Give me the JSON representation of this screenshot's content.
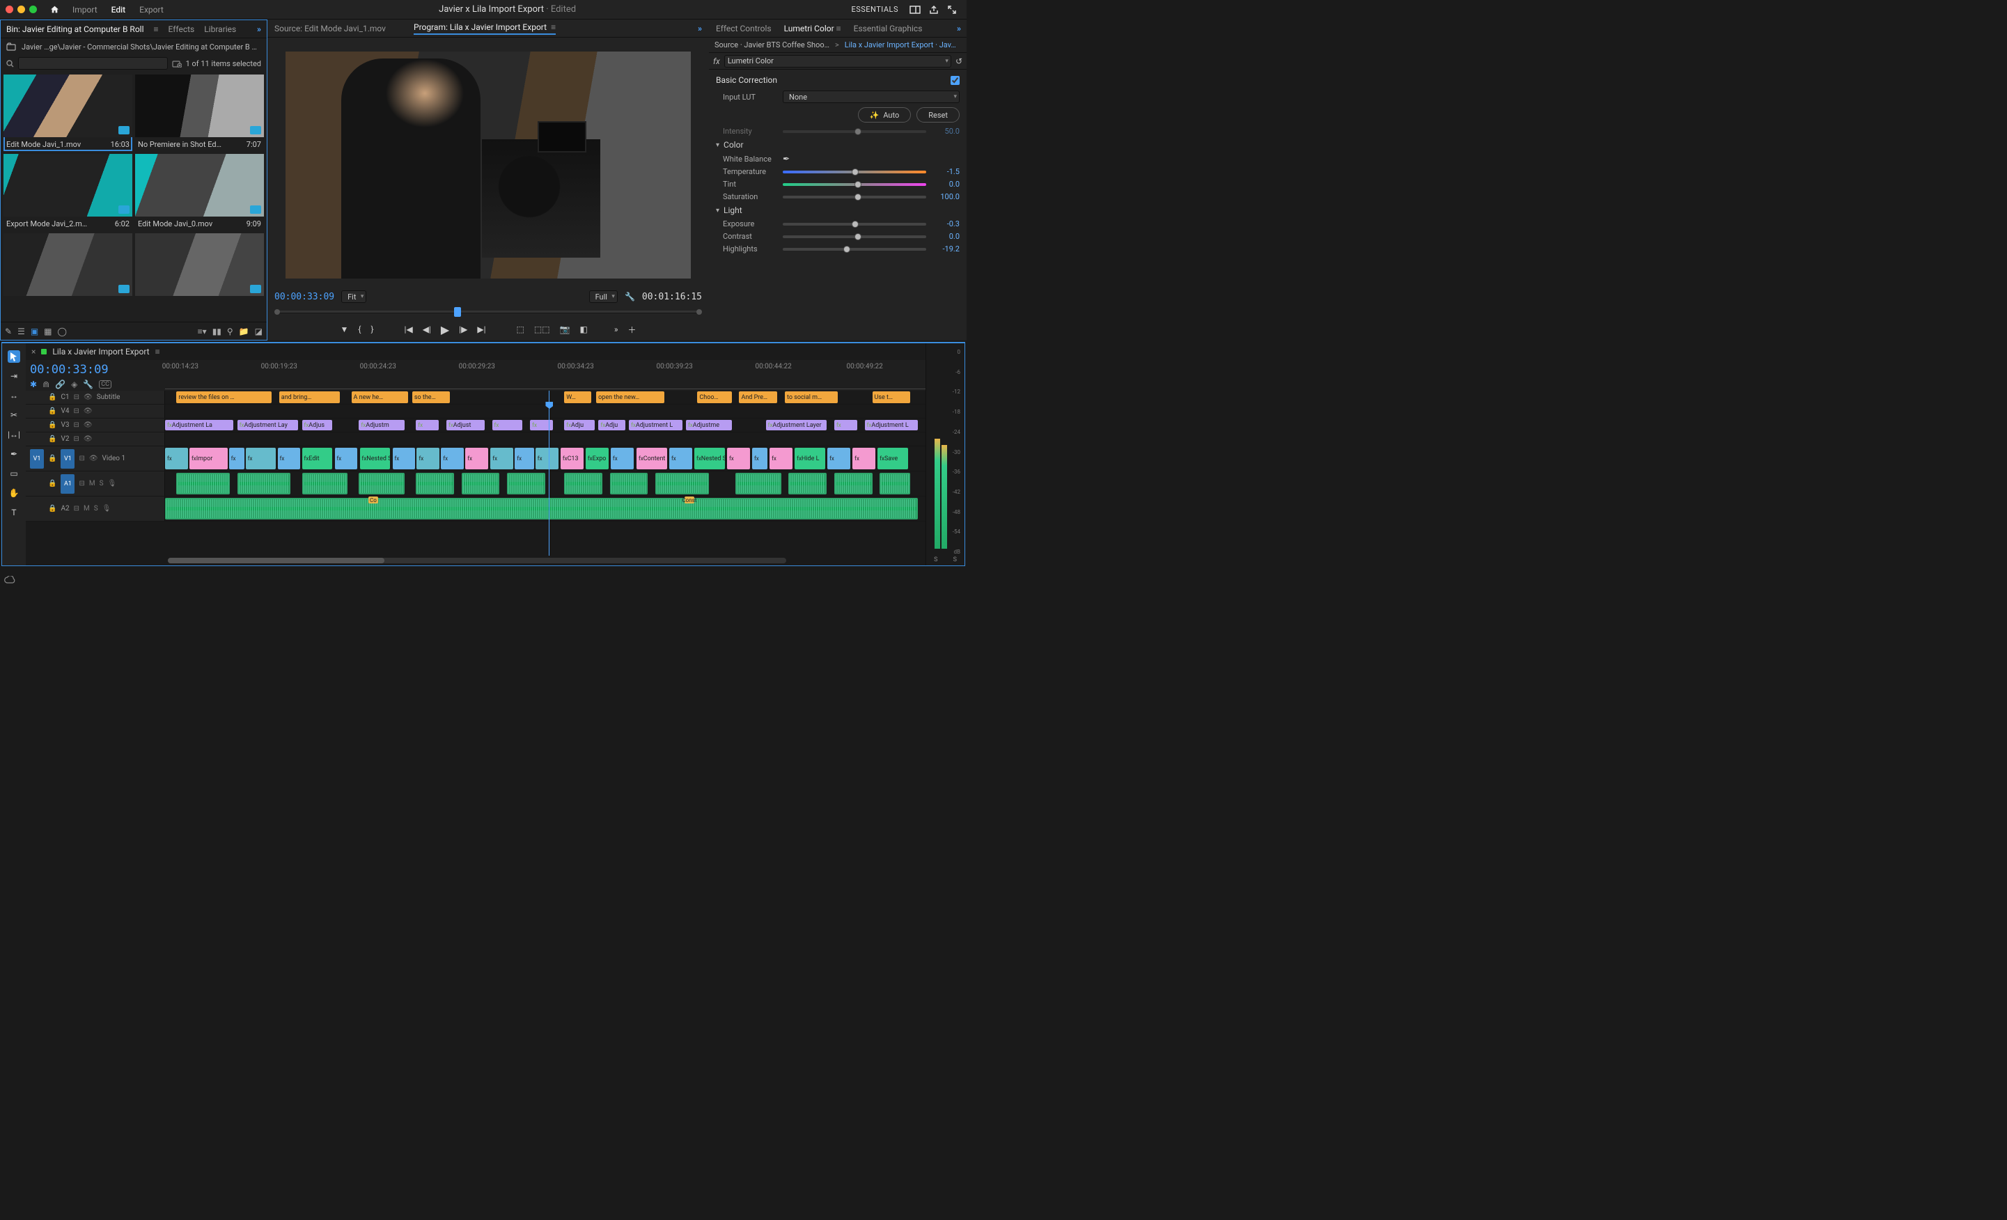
{
  "top": {
    "tabs": [
      "Import",
      "Edit",
      "Export"
    ],
    "active_tab": "Edit",
    "doc_title": "Javier x Lila Import Export",
    "doc_status": "Edited",
    "workspace": "ESSENTIALS"
  },
  "project": {
    "tabs": {
      "bin": "Bin: Javier Editing at Computer B Roll",
      "effects": "Effects",
      "libraries": "Libraries"
    },
    "breadcrumb": "Javier …ge\\Javier - Commercial Shots\\Javier Editing at Computer B Roll",
    "filter_status": "1 of 11 items selected",
    "search_placeholder": "",
    "clips": [
      {
        "name": "Edit Mode Javi_1.mov",
        "dur": "16:03",
        "selected": true,
        "thumb": "th1"
      },
      {
        "name": "No Premiere in Shot Editi…",
        "dur": "7:07",
        "selected": false,
        "thumb": "th2"
      },
      {
        "name": "Export Mode Javi_2.mov",
        "dur": "6:02",
        "selected": false,
        "thumb": "th3"
      },
      {
        "name": "Edit Mode Javi_0.mov",
        "dur": "9:09",
        "selected": false,
        "thumb": "th4"
      },
      {
        "name": "",
        "dur": "",
        "selected": false,
        "thumb": "th5"
      },
      {
        "name": "",
        "dur": "",
        "selected": false,
        "thumb": "th6"
      }
    ]
  },
  "viewer": {
    "source_tab": "Source: Edit Mode Javi_1.mov",
    "program_tab": "Program: Lila x Javier Import Export",
    "current_tc": "00:00:33:09",
    "fit": "Fit",
    "zoom": "Full",
    "duration_tc": "00:01:16:15"
  },
  "lumetri": {
    "tabs": {
      "ec": "Effect Controls",
      "lc": "Lumetri Color",
      "eg": "Essential Graphics"
    },
    "source_line": "Source · Javier BTS Coffee Shoot…",
    "seq_line": "Lila x Javier Import Export · Jav…",
    "effect_name": "Lumetri Color",
    "section": "Basic Correction",
    "input_lut_label": "Input LUT",
    "input_lut_value": "None",
    "auto": "Auto",
    "reset": "Reset",
    "intensity_label": "Intensity",
    "intensity_value": "50.0",
    "color_group": "Color",
    "wb_label": "White Balance",
    "light_group": "Light",
    "params": {
      "temperature": {
        "label": "Temperature",
        "value": "-1.5",
        "knob": 48
      },
      "tint": {
        "label": "Tint",
        "value": "0.0",
        "knob": 50
      },
      "saturation": {
        "label": "Saturation",
        "value": "100.0",
        "knob": 50
      },
      "exposure": {
        "label": "Exposure",
        "value": "-0.3",
        "knob": 48
      },
      "contrast": {
        "label": "Contrast",
        "value": "0.0",
        "knob": 50
      },
      "highlights": {
        "label": "Highlights",
        "value": "-19.2",
        "knob": 42
      }
    }
  },
  "timeline": {
    "sequence_name": "Lila x Javier Import Export",
    "playhead_tc": "00:00:33:09",
    "playhead_pct": 50.5,
    "ruler": [
      {
        "t": "00:00:14:23",
        "p": 2
      },
      {
        "t": "00:00:19:23",
        "p": 15
      },
      {
        "t": "00:00:24:23",
        "p": 28
      },
      {
        "t": "00:00:29:23",
        "p": 41
      },
      {
        "t": "00:00:34:23",
        "p": 54
      },
      {
        "t": "00:00:39:23",
        "p": 67
      },
      {
        "t": "00:00:44:22",
        "p": 80
      },
      {
        "t": "00:00:49:22",
        "p": 92
      }
    ],
    "tracks": {
      "subtitle": {
        "label": "Subtitle",
        "id": "C1"
      },
      "v4": "V4",
      "v3": "V3",
      "v2": "V2",
      "v1": "V1",
      "v1_name": "Video 1",
      "a1": "A1",
      "a2": "A2"
    },
    "subtitles": [
      {
        "l": 1.5,
        "w": 12.5,
        "t": "review the files on …"
      },
      {
        "l": 15,
        "w": 8,
        "t": "and bring…"
      },
      {
        "l": 24.5,
        "w": 7.5,
        "t": "A new he…"
      },
      {
        "l": 32.5,
        "w": 5,
        "t": "so the…"
      },
      {
        "l": 52.5,
        "w": 3.5,
        "t": "W…"
      },
      {
        "l": 56.7,
        "w": 9,
        "t": "open the new…"
      },
      {
        "l": 70,
        "w": 4.5,
        "t": "Choo…"
      },
      {
        "l": 75.5,
        "w": 5,
        "t": "And Pre…"
      },
      {
        "l": 81.5,
        "w": 7,
        "t": "to social m…"
      },
      {
        "l": 93,
        "w": 5,
        "t": "Use t…"
      }
    ],
    "adjustments": [
      {
        "l": 0,
        "w": 9,
        "t": "Adjustment La"
      },
      {
        "l": 9.5,
        "w": 8,
        "t": "Adjustment Lay"
      },
      {
        "l": 18,
        "w": 4,
        "t": "Adjus"
      },
      {
        "l": 25.5,
        "w": 6,
        "t": "Adjustm"
      },
      {
        "l": 33,
        "w": 3,
        "t": ""
      },
      {
        "l": 37,
        "w": 5,
        "t": "Adjust"
      },
      {
        "l": 43,
        "w": 4,
        "t": ""
      },
      {
        "l": 48,
        "w": 3,
        "t": ""
      },
      {
        "l": 52.5,
        "w": 4,
        "t": "Adju"
      },
      {
        "l": 57,
        "w": 3.5,
        "t": "Adju"
      },
      {
        "l": 61,
        "w": 7,
        "t": "Adjustment L"
      },
      {
        "l": 68.5,
        "w": 6,
        "t": "Adjustme"
      },
      {
        "l": 79,
        "w": 8,
        "t": "Adjustment Layer"
      },
      {
        "l": 88,
        "w": 3,
        "t": ""
      },
      {
        "l": 92,
        "w": 7,
        "t": "Adjustment L"
      }
    ],
    "v1_clips": [
      {
        "l": 0,
        "w": 3,
        "c": "v1c",
        "t": ""
      },
      {
        "l": 3.2,
        "w": 5,
        "c": "pink",
        "t": "Impor"
      },
      {
        "l": 8.4,
        "w": 2,
        "c": "blu",
        "t": ""
      },
      {
        "l": 10.6,
        "w": 4,
        "c": "v1c",
        "t": ""
      },
      {
        "l": 14.8,
        "w": 3,
        "c": "blu",
        "t": ""
      },
      {
        "l": 18,
        "w": 4,
        "c": "grn",
        "t": "Edit"
      },
      {
        "l": 22.3,
        "w": 3,
        "c": "blu",
        "t": ""
      },
      {
        "l": 25.6,
        "w": 4,
        "c": "grn",
        "t": "Nested S"
      },
      {
        "l": 29.9,
        "w": 3,
        "c": "blu",
        "t": ""
      },
      {
        "l": 33.1,
        "w": 3,
        "c": "v1c",
        "t": ""
      },
      {
        "l": 36.3,
        "w": 3,
        "c": "blu",
        "t": ""
      },
      {
        "l": 39.5,
        "w": 3,
        "c": "pink",
        "t": ""
      },
      {
        "l": 42.8,
        "w": 3,
        "c": "v1c",
        "t": ""
      },
      {
        "l": 46,
        "w": 2.5,
        "c": "blu",
        "t": ""
      },
      {
        "l": 48.7,
        "w": 3,
        "c": "v1c",
        "t": ""
      },
      {
        "l": 52,
        "w": 3,
        "c": "pink",
        "t": "C13"
      },
      {
        "l": 55.3,
        "w": 3,
        "c": "grn",
        "t": "Expo"
      },
      {
        "l": 58.6,
        "w": 3,
        "c": "blu",
        "t": ""
      },
      {
        "l": 62,
        "w": 4,
        "c": "pink",
        "t": "Content"
      },
      {
        "l": 66.3,
        "w": 3,
        "c": "blu",
        "t": ""
      },
      {
        "l": 69.6,
        "w": 4,
        "c": "grn",
        "t": "Nested S"
      },
      {
        "l": 73.9,
        "w": 3,
        "c": "pink",
        "t": ""
      },
      {
        "l": 77.2,
        "w": 2,
        "c": "blu",
        "t": ""
      },
      {
        "l": 79.5,
        "w": 3,
        "c": "pink",
        "t": ""
      },
      {
        "l": 82.8,
        "w": 4,
        "c": "grn",
        "t": "Hide L"
      },
      {
        "l": 87.1,
        "w": 3,
        "c": "blu",
        "t": ""
      },
      {
        "l": 90.4,
        "w": 3,
        "c": "pink",
        "t": ""
      },
      {
        "l": 93.7,
        "w": 4,
        "c": "grn",
        "t": "Save"
      }
    ],
    "a1_clips": [
      {
        "l": 1.5,
        "w": 7
      },
      {
        "l": 9.5,
        "w": 7
      },
      {
        "l": 18,
        "w": 6
      },
      {
        "l": 25.5,
        "w": 6
      },
      {
        "l": 33,
        "w": 5
      },
      {
        "l": 39,
        "w": 5
      },
      {
        "l": 45,
        "w": 5
      },
      {
        "l": 52.5,
        "w": 5
      },
      {
        "l": 58.5,
        "w": 5
      },
      {
        "l": 64.5,
        "w": 7
      },
      {
        "l": 75,
        "w": 6
      },
      {
        "l": 82,
        "w": 5
      },
      {
        "l": 88,
        "w": 5
      },
      {
        "l": 94,
        "w": 4
      }
    ],
    "a2": {
      "l": 0,
      "w": 99,
      "markers": [
        {
          "p": 27,
          "t": "Co"
        },
        {
          "p": 69,
          "t": "Const"
        }
      ]
    },
    "meter_ticks": [
      "0",
      "-6",
      "-12",
      "-18",
      "-24",
      "-30",
      "-36",
      "-42",
      "-48",
      "-54",
      "dB"
    ],
    "meter_foot": [
      "S",
      "S"
    ]
  }
}
